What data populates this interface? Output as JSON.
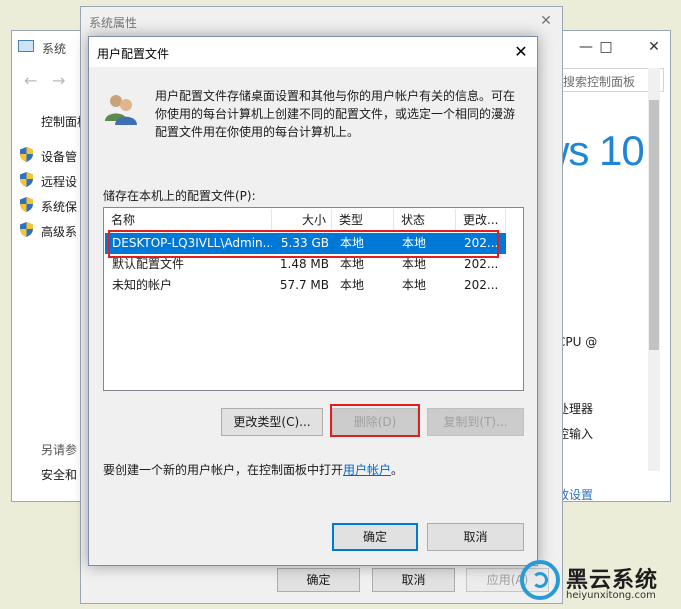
{
  "system_window": {
    "title": "系统",
    "search_placeholder": "搜索控制面板",
    "nav": {
      "back": "←",
      "forward": "→"
    },
    "sidebar": {
      "home": "控制面板",
      "items": [
        "设备管",
        "远程设",
        "系统保",
        "高级系"
      ]
    },
    "see_also": {
      "heading": "另请参",
      "item": "安全和"
    },
    "brand_text": "ws 10",
    "right_texts": [
      "CPU @",
      "处理器",
      "控输入"
    ],
    "change_settings_link": "改设置"
  },
  "properties_window": {
    "title": "系统属性",
    "ok": "确定",
    "cancel": "取消",
    "apply": "应用(A)"
  },
  "dialog": {
    "title": "用户配置文件",
    "close": "✕",
    "description": "用户配置文件存储桌面设置和其他与你的用户帐户有关的信息。可在你使用的每台计算机上创建不同的配置文件，或选定一个相同的漫游配置文件用在你使用的每台计算机上。",
    "list_label": "储存在本机上的配置文件(P):",
    "columns": {
      "name": "名称",
      "size": "大小",
      "type": "类型",
      "status": "状态",
      "modified": "更改..."
    },
    "rows": [
      {
        "name": "DESKTOP-LQ3IVLL\\Admin...",
        "size": "5.33 GB",
        "type": "本地",
        "status": "本地",
        "modified": "202..."
      },
      {
        "name": "默认配置文件",
        "size": "1.48 MB",
        "type": "本地",
        "status": "本地",
        "modified": "202..."
      },
      {
        "name": "未知的帐户",
        "size": "57.7 MB",
        "type": "本地",
        "status": "本地",
        "modified": "202..."
      }
    ],
    "buttons": {
      "change_type": "更改类型(C)...",
      "delete": "删除(D)",
      "copy_to": "复制到(T)..."
    },
    "hint_prefix": "要创建一个新的用户帐户，在控制面板中打开",
    "hint_link": "用户帐户",
    "hint_suffix": "。",
    "ok": "确定",
    "cancel": "取消"
  },
  "watermark": {
    "title": "黑云系统",
    "url": "heiyunxitong.com"
  },
  "colors": {
    "selection": "#0078d7",
    "highlight_box": "#e02020",
    "link": "#0066cc"
  }
}
